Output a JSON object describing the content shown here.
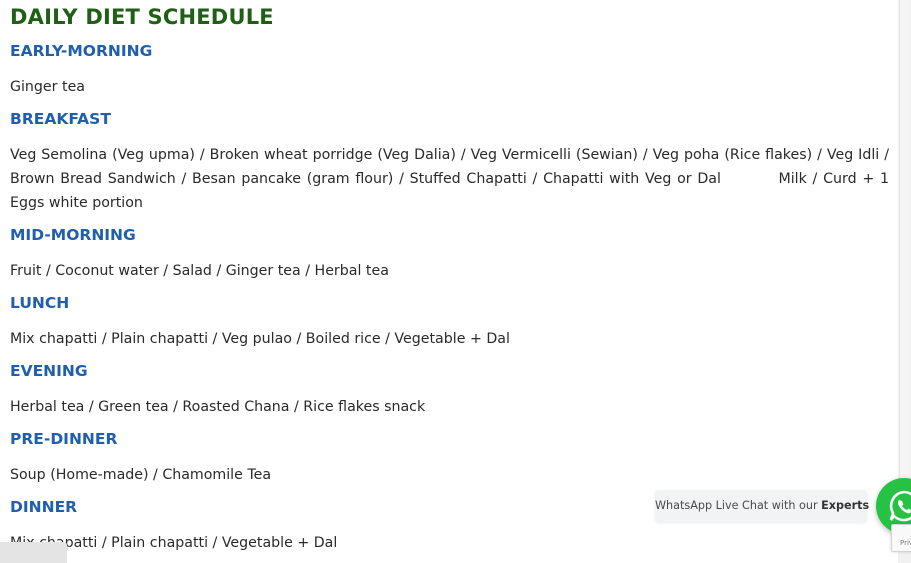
{
  "page": {
    "title": "DAILY DIET SCHEDULE",
    "sections": [
      {
        "heading": "EARLY-MORNING",
        "text": "Ginger tea"
      },
      {
        "heading": "BREAKFAST",
        "text": "Veg Semolina (Veg upma) / Broken wheat porridge (Veg Dalia) / Veg Vermicelli (Sewian) / Veg poha (Rice flakes) / Veg Idli / Brown Bread Sandwich / Besan pancake (gram flour) / Stuffed Chapatti / Chapatti with Veg or Dal          Milk / Curd + 1 Eggs white portion"
      },
      {
        "heading": "MID-MORNING",
        "text": "Fruit / Coconut water / Salad / Ginger tea / Herbal tea"
      },
      {
        "heading": "LUNCH",
        "text": "Mix chapatti / Plain chapatti / Veg pulao / Boiled rice / Vegetable + Dal"
      },
      {
        "heading": "EVENING",
        "text": "Herbal tea / Green tea / Roasted Chana / Rice flakes snack"
      },
      {
        "heading": "PRE-DINNER",
        "text": "Soup (Home-made) / Chamomile Tea"
      },
      {
        "heading": "DINNER",
        "text": "Mix chapatti / Plain chapatti / Vegetable + Dal"
      }
    ]
  },
  "whatsapp": {
    "chat_label": "WhatsApp Live Chat with our",
    "chat_label_bold": "Experts",
    "icon": "whatsapp-icon"
  },
  "recaptcha": {
    "label": "Priv"
  },
  "colors": {
    "title": "#1f5f16",
    "heading": "#1f5fae",
    "whatsapp_green": "#25c244"
  }
}
